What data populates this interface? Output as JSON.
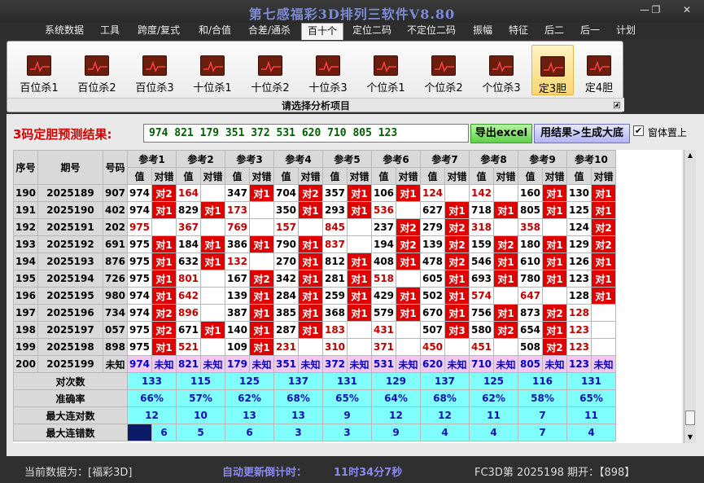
{
  "window": {
    "title": "第七感福彩3D排列三软件V8.80",
    "minimize": "—",
    "restore": "❐",
    "close": "✕"
  },
  "menu": [
    "系统数据",
    "工具",
    "跨度/复式",
    "和/合值",
    "合差/通杀",
    "百十个",
    "定位二码",
    "不定位二码",
    "振幅",
    "特征",
    "后二",
    "后一",
    "计划"
  ],
  "menu_active_index": 5,
  "ribbon": {
    "buttons": [
      "百位杀1",
      "百位杀2",
      "百位杀3",
      "十位杀1",
      "十位杀2",
      "十位杀3",
      "个位杀1",
      "个位杀2",
      "个位杀3",
      "定3胆",
      "定4胆"
    ],
    "selected_index": 9,
    "caption": "请选择分析项目",
    "icon": "chart-icon"
  },
  "result": {
    "label": "3码定胆预测结果:",
    "value": "974 821 179 351 372 531 620 710 805 123",
    "excel_button": "导出excel",
    "generate_button": "用结果>生成大底",
    "topmost_checkbox": "窗体置上",
    "topmost_checked": true
  },
  "grid": {
    "headers": {
      "seq": "序号",
      "issue": "期号",
      "code": "号码",
      "refs": [
        "参考1",
        "参考2",
        "参考3",
        "参考4",
        "参考5",
        "参考6",
        "参考7",
        "参考8",
        "参考9",
        "参考10"
      ],
      "val": "值",
      "hit": "对错"
    },
    "rows": [
      {
        "seq": "190",
        "issue": "2025189",
        "code": "907",
        "vals": [
          [
            "974",
            "对2",
            0
          ],
          [
            "164",
            "",
            1
          ],
          [
            "347",
            "对1",
            0
          ],
          [
            "704",
            "对2",
            0
          ],
          [
            "357",
            "对1",
            0
          ],
          [
            "106",
            "对1",
            0
          ],
          [
            "124",
            "",
            1
          ],
          [
            "142",
            "",
            1
          ],
          [
            "160",
            "对1",
            0
          ],
          [
            "130",
            "对1",
            0
          ]
        ]
      },
      {
        "seq": "191",
        "issue": "2025190",
        "code": "402",
        "vals": [
          [
            "974",
            "对1",
            0
          ],
          [
            "829",
            "对1",
            0
          ],
          [
            "173",
            "",
            1
          ],
          [
            "350",
            "对1",
            0
          ],
          [
            "293",
            "对1",
            0
          ],
          [
            "536",
            "",
            1
          ],
          [
            "627",
            "对1",
            0
          ],
          [
            "718",
            "对1",
            0
          ],
          [
            "805",
            "对1",
            0
          ],
          [
            "125",
            "对1",
            0
          ]
        ]
      },
      {
        "seq": "192",
        "issue": "2025191",
        "code": "202",
        "vals": [
          [
            "975",
            "",
            1
          ],
          [
            "367",
            "",
            1
          ],
          [
            "769",
            "",
            1
          ],
          [
            "157",
            "",
            1
          ],
          [
            "845",
            "",
            1
          ],
          [
            "237",
            "对2",
            0
          ],
          [
            "279",
            "对2",
            0
          ],
          [
            "318",
            "",
            1
          ],
          [
            "358",
            "",
            1
          ],
          [
            "124",
            "对2",
            0
          ]
        ]
      },
      {
        "seq": "193",
        "issue": "2025192",
        "code": "691",
        "vals": [
          [
            "975",
            "对1",
            0
          ],
          [
            "184",
            "对1",
            0
          ],
          [
            "386",
            "对1",
            0
          ],
          [
            "790",
            "对1",
            0
          ],
          [
            "837",
            "",
            1
          ],
          [
            "194",
            "对2",
            0
          ],
          [
            "139",
            "对2",
            0
          ],
          [
            "159",
            "对2",
            0
          ],
          [
            "180",
            "对1",
            0
          ],
          [
            "129",
            "对2",
            0
          ]
        ]
      },
      {
        "seq": "194",
        "issue": "2025193",
        "code": "876",
        "vals": [
          [
            "975",
            "对1",
            0
          ],
          [
            "632",
            "对1",
            0
          ],
          [
            "132",
            "",
            1
          ],
          [
            "270",
            "对1",
            0
          ],
          [
            "812",
            "对1",
            0
          ],
          [
            "408",
            "对1",
            0
          ],
          [
            "478",
            "对2",
            0
          ],
          [
            "546",
            "对1",
            0
          ],
          [
            "610",
            "对1",
            0
          ],
          [
            "126",
            "对1",
            0
          ]
        ]
      },
      {
        "seq": "195",
        "issue": "2025194",
        "code": "726",
        "vals": [
          [
            "975",
            "对1",
            0
          ],
          [
            "801",
            "",
            1
          ],
          [
            "167",
            "对2",
            0
          ],
          [
            "342",
            "对1",
            0
          ],
          [
            "281",
            "对1",
            0
          ],
          [
            "518",
            "",
            1
          ],
          [
            "605",
            "对1",
            0
          ],
          [
            "693",
            "对1",
            0
          ],
          [
            "780",
            "对1",
            0
          ],
          [
            "123",
            "对1",
            0
          ]
        ]
      },
      {
        "seq": "196",
        "issue": "2025195",
        "code": "980",
        "vals": [
          [
            "974",
            "对1",
            0
          ],
          [
            "642",
            "",
            1
          ],
          [
            "139",
            "对1",
            0
          ],
          [
            "284",
            "对1",
            0
          ],
          [
            "259",
            "对1",
            0
          ],
          [
            "429",
            "对1",
            0
          ],
          [
            "502",
            "对1",
            0
          ],
          [
            "574",
            "",
            1
          ],
          [
            "647",
            "",
            1
          ],
          [
            "128",
            "对1",
            0
          ]
        ]
      },
      {
        "seq": "197",
        "issue": "2025196",
        "code": "734",
        "vals": [
          [
            "974",
            "对2",
            0
          ],
          [
            "896",
            "",
            1
          ],
          [
            "387",
            "对1",
            0
          ],
          [
            "385",
            "对1",
            0
          ],
          [
            "368",
            "对1",
            0
          ],
          [
            "579",
            "对1",
            0
          ],
          [
            "670",
            "对1",
            0
          ],
          [
            "756",
            "对1",
            0
          ],
          [
            "873",
            "对2",
            0
          ],
          [
            "128",
            "",
            1
          ]
        ]
      },
      {
        "seq": "198",
        "issue": "2025197",
        "code": "057",
        "vals": [
          [
            "975",
            "对2",
            0
          ],
          [
            "671",
            "对1",
            0
          ],
          [
            "140",
            "对1",
            0
          ],
          [
            "287",
            "对1",
            0
          ],
          [
            "183",
            "",
            1
          ],
          [
            "431",
            "",
            1
          ],
          [
            "507",
            "对3",
            0
          ],
          [
            "580",
            "对2",
            0
          ],
          [
            "654",
            "对1",
            0
          ],
          [
            "123",
            "",
            1
          ]
        ]
      },
      {
        "seq": "199",
        "issue": "2025198",
        "code": "898",
        "vals": [
          [
            "975",
            "对1",
            0
          ],
          [
            "521",
            "",
            1
          ],
          [
            "109",
            "对1",
            0
          ],
          [
            "231",
            "",
            1
          ],
          [
            "310",
            "",
            1
          ],
          [
            "371",
            "",
            1
          ],
          [
            "450",
            "",
            1
          ],
          [
            "451",
            "",
            1
          ],
          [
            "508",
            "对2",
            0
          ],
          [
            "123",
            "",
            1
          ]
        ]
      }
    ],
    "forecast": {
      "seq": "200",
      "issue": "2025199",
      "code": "未知",
      "vals": [
        "974",
        "821",
        "179",
        "351",
        "372",
        "531",
        "620",
        "710",
        "805",
        "123"
      ],
      "hit": "未知"
    },
    "stats": [
      {
        "label": "对次数",
        "values": [
          "133",
          "115",
          "125",
          "137",
          "131",
          "129",
          "137",
          "125",
          "116",
          "131"
        ]
      },
      {
        "label": "准确率",
        "values": [
          "66%",
          "57%",
          "62%",
          "68%",
          "65%",
          "64%",
          "68%",
          "62%",
          "58%",
          "65%"
        ]
      },
      {
        "label": "最大连对数",
        "values": [
          "12",
          "10",
          "13",
          "13",
          "9",
          "12",
          "12",
          "11",
          "7",
          "11"
        ]
      },
      {
        "label": "最大连错数",
        "values": [
          "6",
          "5",
          "6",
          "3",
          "3",
          "9",
          "4",
          "4",
          "7",
          "4"
        ]
      }
    ]
  },
  "status": {
    "current_data": "当前数据为：[福彩3D]",
    "countdown_label": "自动更新倒计时：",
    "countdown": "11时34分7秒",
    "issue_info": "FC3D第 2025198 期开：【898】"
  },
  "colors": {
    "mark_red": "#e00000",
    "forecast_pink": "#f3c8f3",
    "stats_cyan": "#80ffff",
    "result_green": "#006000"
  }
}
